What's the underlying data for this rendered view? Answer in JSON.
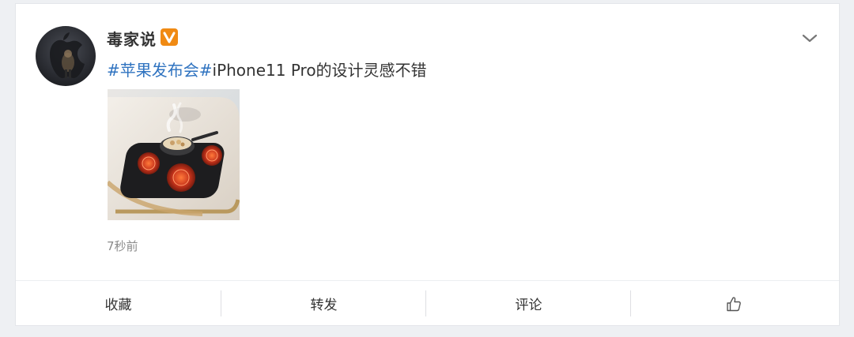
{
  "post": {
    "author": {
      "name": "毒家说",
      "badge_icon": "verified-v-icon",
      "badge_color": "#f08a13"
    },
    "menu_icon": "chevron-down-icon",
    "text": {
      "topic": "#苹果发布会#",
      "body": "iPhone11 Pro的设计灵感不错"
    },
    "image_subject": "iPhone camera module styled as cooktop with frying pan",
    "time": "7秒前"
  },
  "actions": {
    "favorite": "收藏",
    "repost": "转发",
    "comment": "评论",
    "like_icon": "thumbs-up-icon"
  },
  "colors": {
    "topic_link": "#2f73c0",
    "text": "#333333",
    "muted": "#8a8a8a",
    "background": "#eef0f3"
  }
}
